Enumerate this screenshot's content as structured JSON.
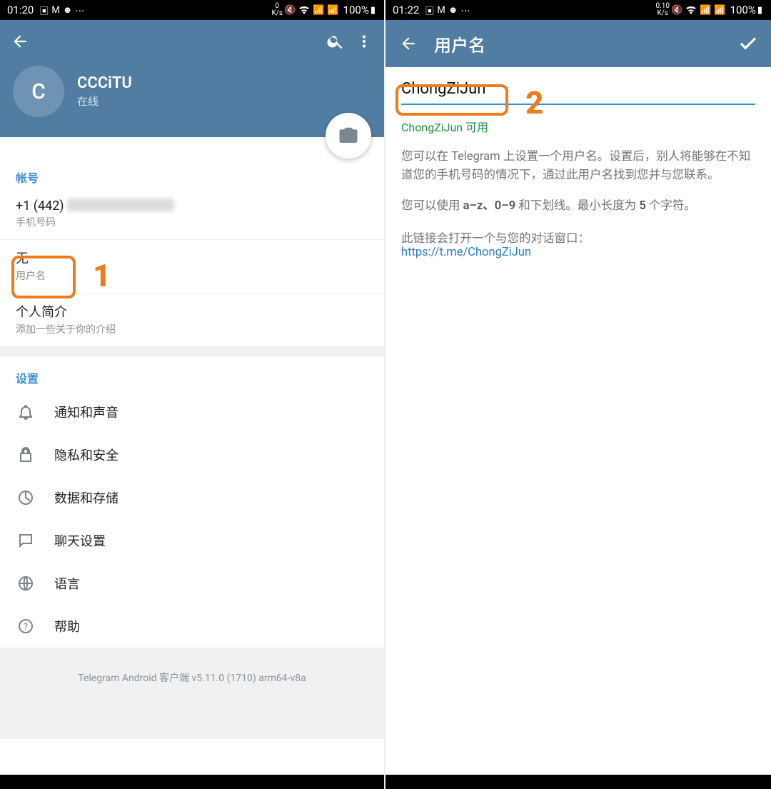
{
  "annotations": {
    "one": "1",
    "two": "2"
  },
  "left": {
    "status": {
      "time": "01:20",
      "net": "K/s",
      "net_num": "0",
      "batt": "100%"
    },
    "profile": {
      "initial": "C",
      "name": "CCCiTU",
      "status": "在线"
    },
    "account": {
      "title": "帐号",
      "phone_prefix": "+1 (442)",
      "phone_label": "手机号码",
      "username_value": "无",
      "username_label": "用户名",
      "bio_title": "个人简介",
      "bio_hint": "添加一些关于你的介绍"
    },
    "settings": {
      "title": "设置",
      "items": [
        {
          "label": "通知和声音"
        },
        {
          "label": "隐私和安全"
        },
        {
          "label": "数据和存储"
        },
        {
          "label": "聊天设置"
        },
        {
          "label": "语言"
        },
        {
          "label": "帮助"
        }
      ]
    },
    "footer": "Telegram Android 客户端 v5.11.0 (1710) arm64-v8a"
  },
  "right": {
    "status": {
      "time": "01:22",
      "net": "K/s",
      "net_num": "0.10",
      "batt": "100%"
    },
    "title": "用户名",
    "username": "ChongZiJun",
    "available": "ChongZiJun 可用",
    "para1": "您可以在 Telegram 上设置一个用户名。设置后，别人将能够在不知道您的手机号码的情况下，通过此用户名找到您并与您联系。",
    "para2_pre": "您可以使用 ",
    "para2_b1": "a–z、0–9",
    "para2_mid": " 和下划线。最小长度为 ",
    "para2_b2": "5",
    "para2_post": " 个字符。",
    "linkline": "此链接会打开一个与您的对话窗口：",
    "link": "https://t.me/ChongZiJun"
  }
}
